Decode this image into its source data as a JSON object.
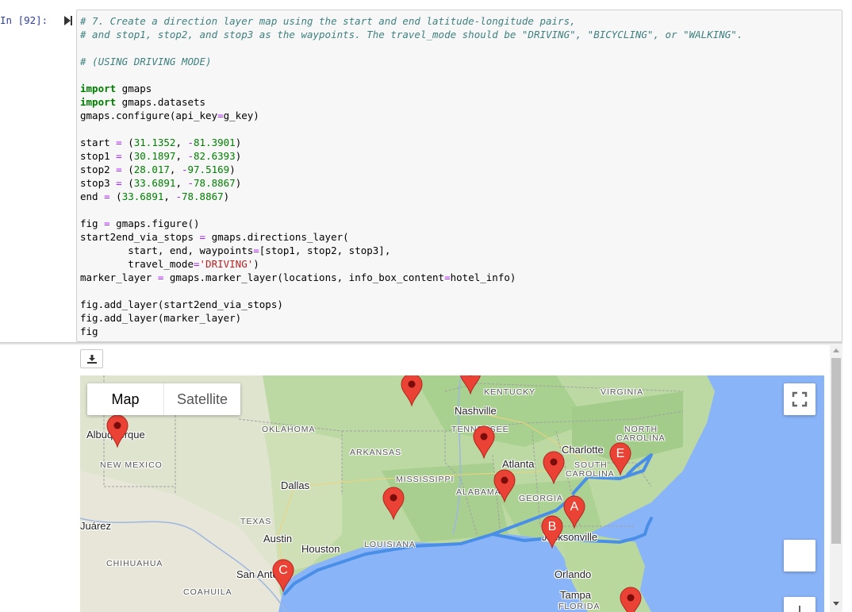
{
  "cell": {
    "prompt": "In [92]:",
    "code_lines": [
      [
        {
          "t": "# 7. Create a direction layer map using the start and end latitude-longitude pairs,",
          "c": "cm"
        }
      ],
      [
        {
          "t": "# and stop1, stop2, and stop3 as the waypoints. The travel_mode should be \"DRIVING\", \"BICYCLING\", or \"WALKING\".",
          "c": "cm"
        }
      ],
      [],
      [
        {
          "t": "# (USING DRIVING MODE)",
          "c": "cm"
        }
      ],
      [],
      [
        {
          "t": "import",
          "c": "kw"
        },
        {
          "t": " gmaps"
        }
      ],
      [
        {
          "t": "import",
          "c": "kw"
        },
        {
          "t": " gmaps.datasets"
        }
      ],
      [
        {
          "t": "gmaps.configure(api_key"
        },
        {
          "t": "=",
          "c": "op"
        },
        {
          "t": "g_key)"
        }
      ],
      [],
      [
        {
          "t": "start "
        },
        {
          "t": "=",
          "c": "op"
        },
        {
          "t": " ("
        },
        {
          "t": "31.1352",
          "c": "nm"
        },
        {
          "t": ", "
        },
        {
          "t": "-",
          "c": "op"
        },
        {
          "t": "81.3901",
          "c": "nm"
        },
        {
          "t": ")"
        }
      ],
      [
        {
          "t": "stop1 "
        },
        {
          "t": "=",
          "c": "op"
        },
        {
          "t": " ("
        },
        {
          "t": "30.1897",
          "c": "nm"
        },
        {
          "t": ", "
        },
        {
          "t": "-",
          "c": "op"
        },
        {
          "t": "82.6393",
          "c": "nm"
        },
        {
          "t": ")"
        }
      ],
      [
        {
          "t": "stop2 "
        },
        {
          "t": "=",
          "c": "op"
        },
        {
          "t": " ("
        },
        {
          "t": "28.017",
          "c": "nm"
        },
        {
          "t": ", "
        },
        {
          "t": "-",
          "c": "op"
        },
        {
          "t": "97.5169",
          "c": "nm"
        },
        {
          "t": ")"
        }
      ],
      [
        {
          "t": "stop3 "
        },
        {
          "t": "=",
          "c": "op"
        },
        {
          "t": " ("
        },
        {
          "t": "33.6891",
          "c": "nm"
        },
        {
          "t": ", "
        },
        {
          "t": "-",
          "c": "op"
        },
        {
          "t": "78.8867",
          "c": "nm"
        },
        {
          "t": ")"
        }
      ],
      [
        {
          "t": "end "
        },
        {
          "t": "=",
          "c": "op"
        },
        {
          "t": " ("
        },
        {
          "t": "33.6891",
          "c": "nm"
        },
        {
          "t": ", "
        },
        {
          "t": "-",
          "c": "op"
        },
        {
          "t": "78.8867",
          "c": "nm"
        },
        {
          "t": ")"
        }
      ],
      [],
      [
        {
          "t": "fig "
        },
        {
          "t": "=",
          "c": "op"
        },
        {
          "t": " gmaps.figure()"
        }
      ],
      [
        {
          "t": "start2end_via_stops "
        },
        {
          "t": "=",
          "c": "op"
        },
        {
          "t": " gmaps.directions_layer("
        }
      ],
      [
        {
          "t": "        start, end, waypoints"
        },
        {
          "t": "=",
          "c": "op"
        },
        {
          "t": "[stop1, stop2, stop3],"
        }
      ],
      [
        {
          "t": "        travel_mode"
        },
        {
          "t": "=",
          "c": "op"
        },
        {
          "t": "'DRIVING'",
          "c": "st"
        },
        {
          "t": ")"
        }
      ],
      [
        {
          "t": "marker_layer "
        },
        {
          "t": "=",
          "c": "op"
        },
        {
          "t": " gmaps.marker_layer(locations, info_box_content"
        },
        {
          "t": "=",
          "c": "op"
        },
        {
          "t": "hotel_info)"
        }
      ],
      [],
      [
        {
          "t": "fig.add_layer(start2end_via_stops)"
        }
      ],
      [
        {
          "t": "fig.add_layer(marker_layer)"
        }
      ],
      [
        {
          "t": "fig"
        }
      ]
    ]
  },
  "output": {
    "download_icon": "download-icon"
  },
  "map": {
    "map_type": {
      "map_label": "Map",
      "satellite_label": "Satellite"
    },
    "fullscreen_icon": "fullscreen-icon",
    "route_color": "#4a8fe7",
    "marker_color": "#ea4335",
    "state_labels": [
      "KENTUCKY",
      "VIRGINIA",
      "OKLAHOMA",
      "TENNESSEE",
      "NORTH",
      "CAROLINA",
      "ARKANSAS",
      "SOUTH",
      "CAROLINA",
      "NEW MEXICO",
      "MISSISSIPPI",
      "ALABAMA",
      "GEORGIA",
      "TEXAS",
      "LOUISIANA",
      "FLORIDA"
    ],
    "mexico_labels": [
      "CHIHUAHUA",
      "COAHUILA"
    ],
    "city_labels": [
      "Nashville",
      "Albuquerque",
      "Charlotte",
      "Atlanta",
      "Dallas",
      "Juárez",
      "Austin",
      "Houston",
      "Jacksonville",
      "San Antonio",
      "Orlando",
      "Tampa"
    ],
    "marker_letters": [
      "A",
      "B",
      "C",
      "E"
    ]
  }
}
